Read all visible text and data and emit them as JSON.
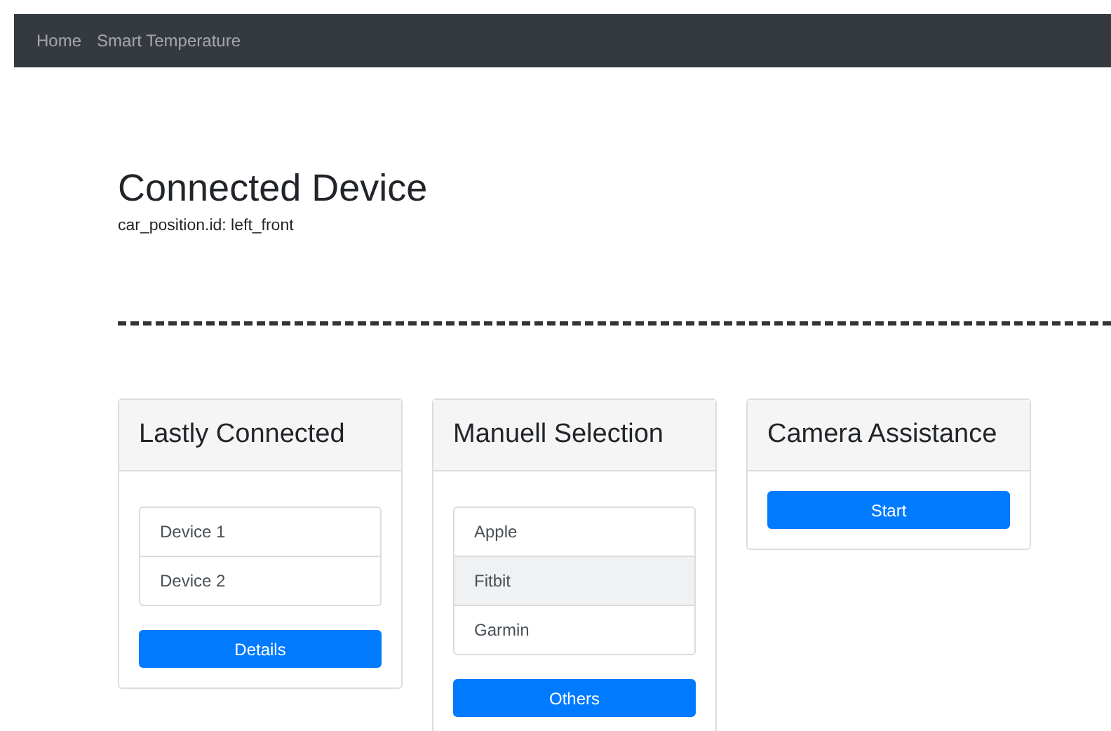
{
  "navbar": {
    "links": [
      {
        "label": "Home"
      },
      {
        "label": "Smart Temperature"
      }
    ]
  },
  "heading": {
    "title": "Connected Device",
    "subtitle": "car_position.id: left_front"
  },
  "cards": [
    {
      "kind": "list",
      "title": "Lastly Connected",
      "items": [
        {
          "label": "Device 1",
          "selected": false
        },
        {
          "label": "Device 2",
          "selected": false
        }
      ],
      "button": "Details"
    },
    {
      "kind": "list",
      "title": "Manuell Selection",
      "items": [
        {
          "label": "Apple",
          "selected": false
        },
        {
          "label": "Fitbit",
          "selected": true
        },
        {
          "label": "Garmin",
          "selected": false
        }
      ],
      "button": "Others"
    },
    {
      "kind": "action",
      "title": "Camera Assistance",
      "button": "Start"
    }
  ]
}
